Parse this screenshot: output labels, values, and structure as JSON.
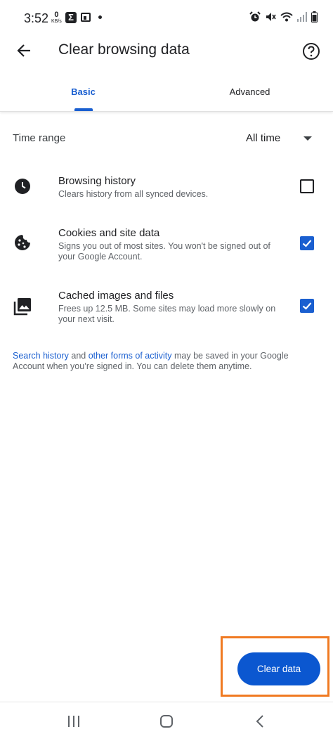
{
  "status_bar": {
    "time": "3:52",
    "net_speed_value": "0",
    "net_speed_unit": "KB/s",
    "icons": [
      "sigma-icon",
      "calendar-icon",
      "dot-icon",
      "alarm-icon",
      "mute-icon",
      "wifi-icon",
      "signal-icon",
      "battery-icon"
    ]
  },
  "appbar": {
    "title": "Clear browsing data",
    "back_icon": "arrow-back-icon",
    "help_icon": "help-icon"
  },
  "tabs": [
    {
      "label": "Basic",
      "selected": true
    },
    {
      "label": "Advanced",
      "selected": false
    }
  ],
  "time_range": {
    "label": "Time range",
    "value": "All time"
  },
  "items": [
    {
      "title": "Browsing history",
      "description": "Clears history from all synced devices.",
      "checked": false,
      "icon": "clock-icon"
    },
    {
      "title": "Cookies and site data",
      "description": "Signs you out of most sites. You won't be signed out of your Google Account.",
      "checked": true,
      "icon": "cookie-icon"
    },
    {
      "title": "Cached images and files",
      "description": "Frees up 12.5 MB. Some sites may load more slowly on your next visit.",
      "checked": true,
      "icon": "images-icon"
    }
  ],
  "footer_note": {
    "link1": "Search history",
    "text1": " and ",
    "link2": "other forms of activity",
    "text2": " may be saved in your Google Account when you’re signed in. You can delete them anytime."
  },
  "clear_button": {
    "label": "Clear data"
  },
  "colors": {
    "accent": "#1a5fd0",
    "button": "#0b57d0",
    "highlight": "#f07a22"
  }
}
